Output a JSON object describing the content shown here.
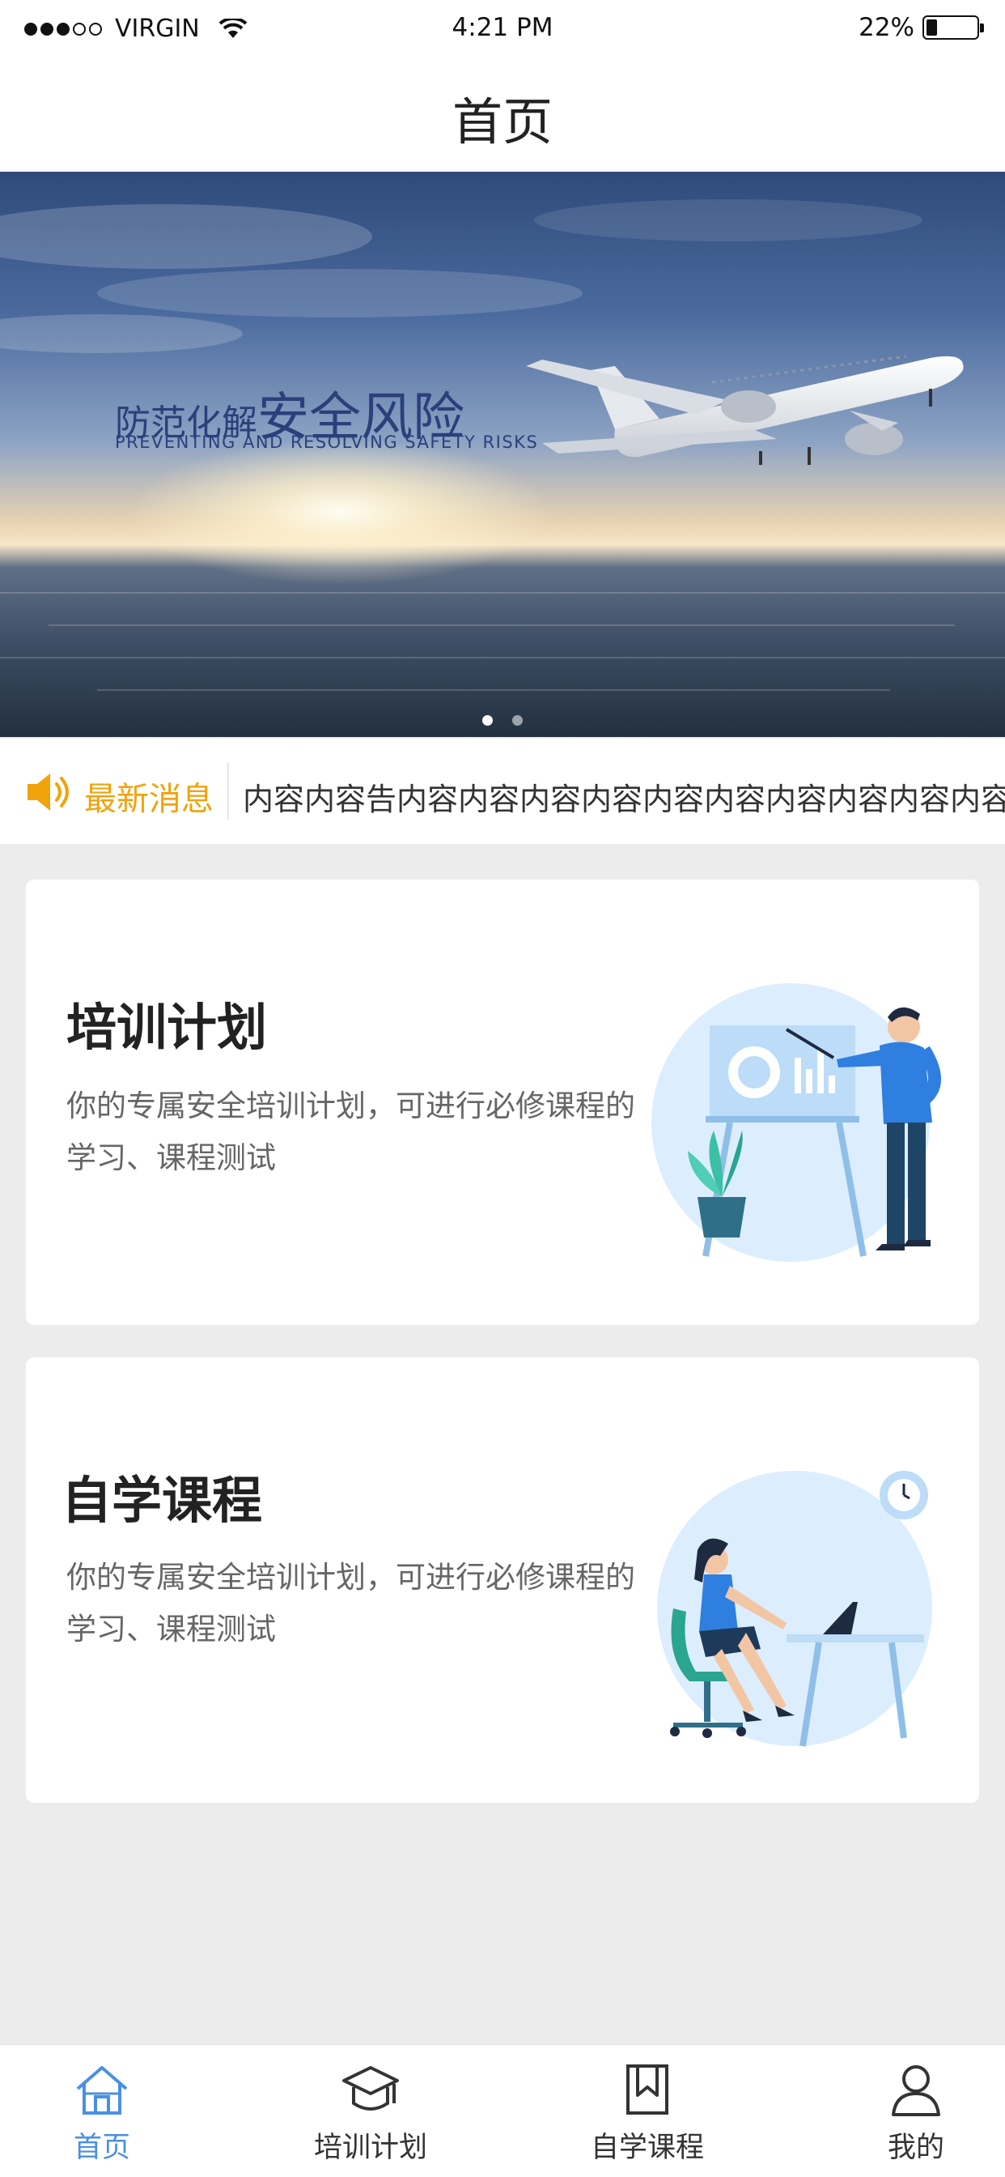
{
  "status_bar": {
    "carrier": "VIRGIN",
    "time": "4:21 PM",
    "battery": "22%",
    "battery_level": 0.22
  },
  "nav": {
    "title": "首页"
  },
  "banner": {
    "headline_small": "防范化解",
    "headline_big": "安全风险",
    "subtitle": "PREVENTING AND RESOLVING SAFETY RISKS",
    "page_count": 2,
    "active_page": 1
  },
  "notice": {
    "label": "最新消息",
    "text": "内容内容告内容内容内容内容内容内容内容内容内容内容内容"
  },
  "cards": [
    {
      "title": "培训计划",
      "desc": "你的专属安全培训计划，可进行必修课程的学习、课程测试",
      "illustration": "teacher-whiteboard-illustration"
    },
    {
      "title": "自学课程",
      "desc": "你的专属安全培训计划，可进行必修课程的学习、课程测试",
      "illustration": "student-laptop-illustration"
    }
  ],
  "tabs": [
    {
      "label": "首页",
      "icon": "home-icon",
      "active": true
    },
    {
      "label": "培训计划",
      "icon": "graduation-cap-icon",
      "active": false
    },
    {
      "label": "自学课程",
      "icon": "book-icon",
      "active": false
    },
    {
      "label": "我的",
      "icon": "user-icon",
      "active": false
    }
  ],
  "colors": {
    "accent": "#4a90e2",
    "notice": "#f0a30a",
    "banner_text": "#2c3f7a",
    "background": "#ececec"
  }
}
